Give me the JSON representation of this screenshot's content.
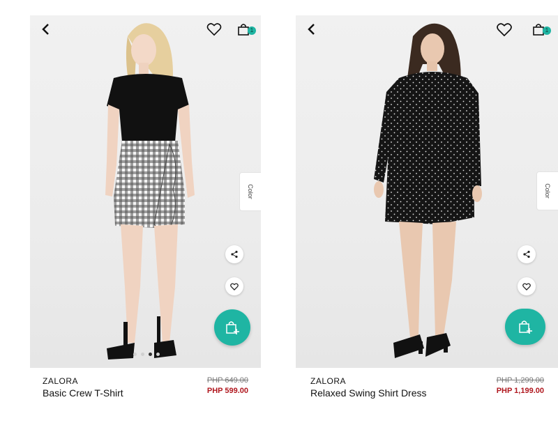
{
  "colors": {
    "accent": "#1fb5a3",
    "sale": "#b0171e"
  },
  "products": [
    {
      "brand": "ZALORA",
      "name": "Basic Crew T-Shirt",
      "old_price": "PHP 649.00",
      "new_price": "PHP 599.00",
      "color_tab": "Color",
      "cart_count": "1",
      "image_dots": 4
    },
    {
      "brand": "ZALORA",
      "name": "Relaxed Swing Shirt Dress",
      "old_price": "PHP 1,299.00",
      "new_price": "PHP 1,199.00",
      "color_tab": "Color",
      "cart_count": "1"
    }
  ],
  "icons": [
    "back-icon",
    "heart-icon",
    "shopping-bag-icon",
    "share-icon",
    "wishlist-icon",
    "add-to-bag-icon"
  ]
}
